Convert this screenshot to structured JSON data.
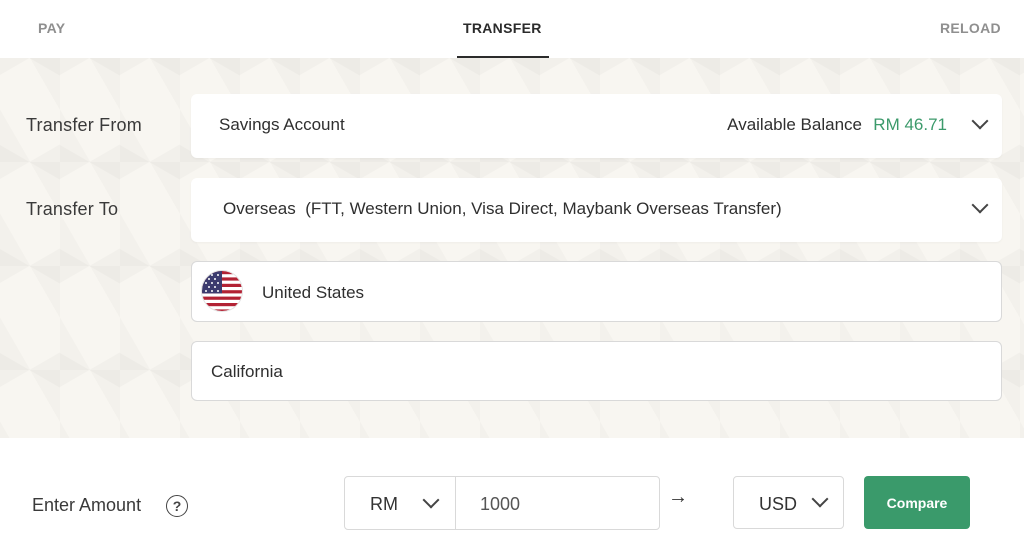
{
  "tabs": {
    "pay": "PAY",
    "transfer": "TRANSFER",
    "reload": "RELOAD",
    "active": "transfer"
  },
  "transfer_from": {
    "label": "Transfer From",
    "account": "Savings Account",
    "balance_label": "Available Balance",
    "balance_value": "RM 46.71"
  },
  "transfer_to": {
    "label": "Transfer To",
    "destination": "Overseas  (FTT, Western Union, Visa Direct, Maybank Overseas Transfer)"
  },
  "country": {
    "name": "United States",
    "flag_icon": "us-flag-icon"
  },
  "state": {
    "name": "California"
  },
  "amount": {
    "label": "Enter Amount",
    "help_symbol": "?",
    "source_currency": "RM",
    "value": "1000",
    "arrow": "→",
    "target_currency": "USD",
    "compare_label": "Compare"
  },
  "colors": {
    "accent_green": "#3a9a6b",
    "balance_green": "#3c9a6b",
    "pattern_bg": "#f8f6f1"
  }
}
